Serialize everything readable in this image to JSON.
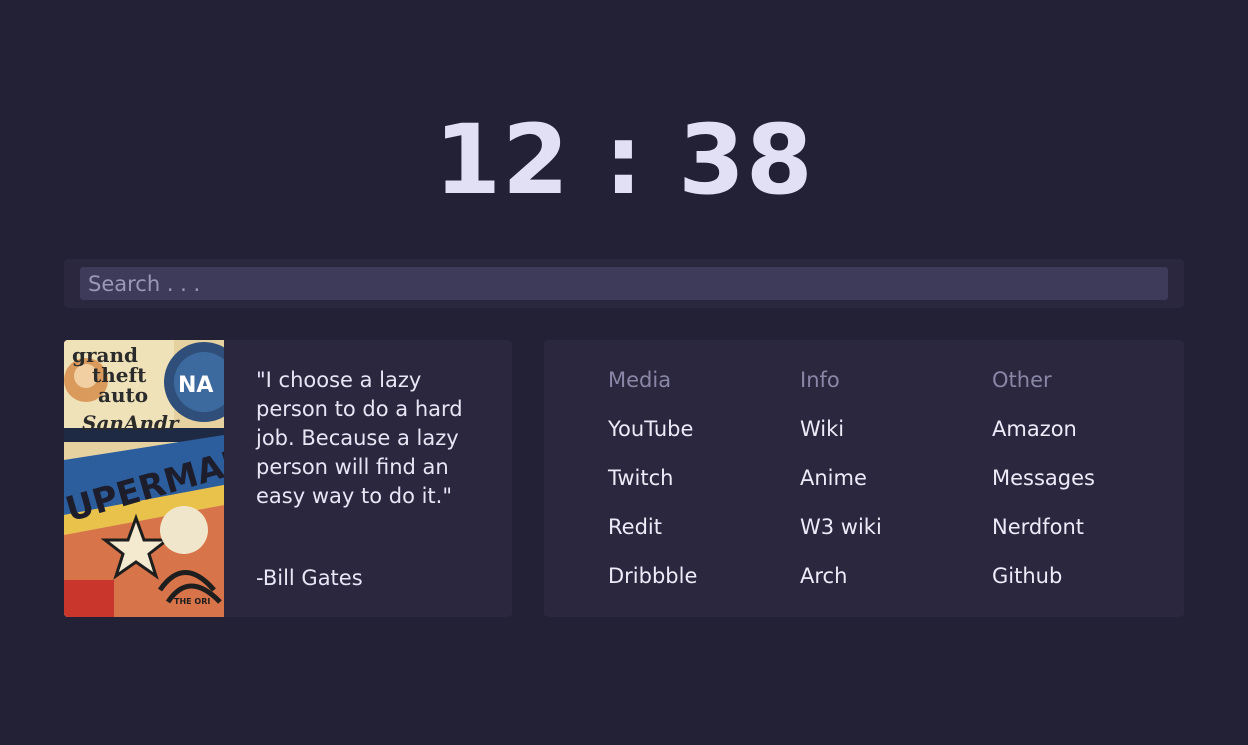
{
  "clock": {
    "hours": "12",
    "separator": ":",
    "minutes": "38"
  },
  "search": {
    "placeholder": "Search . . .",
    "value": ""
  },
  "quote": {
    "text": "\"I choose a lazy person to do a hard job. Because a lazy person will find an easy way to do it.\"",
    "author": "-Bill Gates",
    "poster": {
      "logo_words": [
        "grand",
        "theft",
        "auto",
        "SanAndr",
        "UPERMAN",
        "NA",
        "THE ORI"
      ]
    }
  },
  "links": {
    "columns": [
      {
        "heading": "Media",
        "items": [
          "YouTube",
          "Twitch",
          "Redit",
          "Dribbble"
        ]
      },
      {
        "heading": "Info",
        "items": [
          "Wiki",
          "Anime",
          "W3 wiki",
          "Arch"
        ]
      },
      {
        "heading": "Other",
        "items": [
          "Amazon",
          "Messages",
          "Nerdfont",
          "Github"
        ]
      }
    ]
  },
  "colors": {
    "background": "#232136",
    "card": "#2a273f",
    "search_field": "#3e3a5a",
    "heading": "#8a86a6",
    "text": "#e8e6f5"
  }
}
